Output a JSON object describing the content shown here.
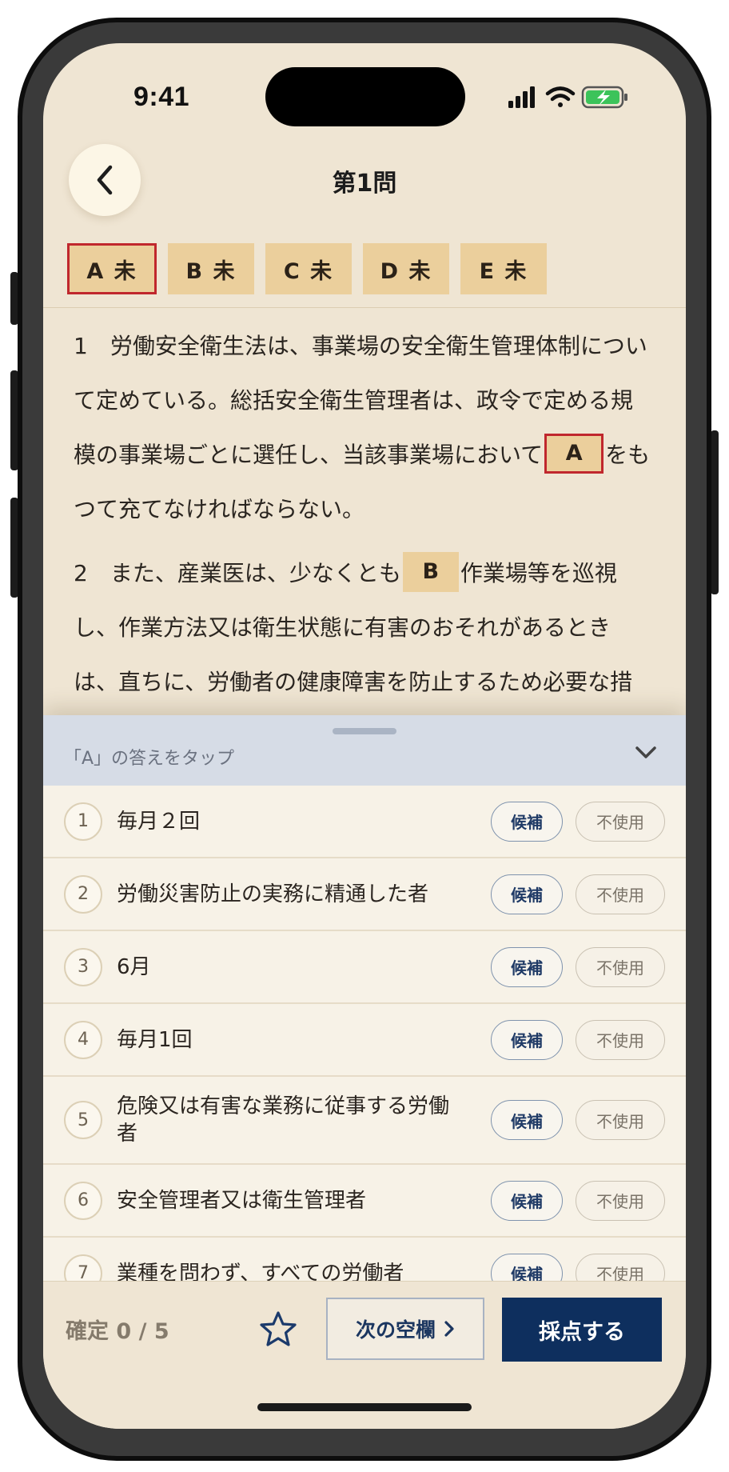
{
  "status_bar": {
    "time": "9:41"
  },
  "header": {
    "title": "第1問"
  },
  "blank_tabs": [
    {
      "letter": "A",
      "state": "未",
      "label": "A 未"
    },
    {
      "letter": "B",
      "state": "未",
      "label": "B 未"
    },
    {
      "letter": "C",
      "state": "未",
      "label": "C 未"
    },
    {
      "letter": "D",
      "state": "未",
      "label": "D 未"
    },
    {
      "letter": "E",
      "state": "未",
      "label": "E 未"
    }
  ],
  "question": {
    "p1_before": "1　労働安全衛生法は、事業場の安全衛生管理体制について定めている。総括安全衛生管理者は、政令で定める規模の事業場ごとに選任し、当該事業場において",
    "p1_blank": "A",
    "p1_after": "をもつて充てなければならない。",
    "p2_before": "2　また、産業医は、少なくとも",
    "p2_blank": "B",
    "p2_after": "作業場等を巡視し、作業方法又は衛生状態に有害のおそれがあるときは、直ちに、労働者の健康障害を防止するため必要な措"
  },
  "sheet": {
    "prompt": "「A」の答えをタップ"
  },
  "options": [
    {
      "num": "1",
      "text": "毎月２回",
      "cand": "候補",
      "unused": "不使用"
    },
    {
      "num": "2",
      "text": "労働災害防止の実務に精通した者",
      "cand": "候補",
      "unused": "不使用"
    },
    {
      "num": "3",
      "text": "6月",
      "cand": "候補",
      "unused": "不使用"
    },
    {
      "num": "4",
      "text": "毎月1回",
      "cand": "候補",
      "unused": "不使用"
    },
    {
      "num": "5",
      "text": "危険又は有害な業務に従事する労働者",
      "cand": "候補",
      "unused": "不使用"
    },
    {
      "num": "6",
      "text": "安全管理者又は衛生管理者",
      "cand": "候補",
      "unused": "不使用"
    },
    {
      "num": "7",
      "text": "業種を問わず、すべての労働者",
      "cand": "候補",
      "unused": "不使用"
    }
  ],
  "footer": {
    "confirm_label": "確定 0 / 5",
    "next_label": "次の空欄",
    "score_label": "採点する"
  },
  "colors": {
    "accent": "#0e2f5e",
    "highlight_border": "#c0272d",
    "blank_fill": "#ebcf9c"
  },
  "icons": [
    "back-chevron-icon",
    "signal-icon",
    "wifi-icon",
    "battery-icon",
    "chevron-down-icon",
    "star-icon",
    "chevron-right-icon"
  ]
}
